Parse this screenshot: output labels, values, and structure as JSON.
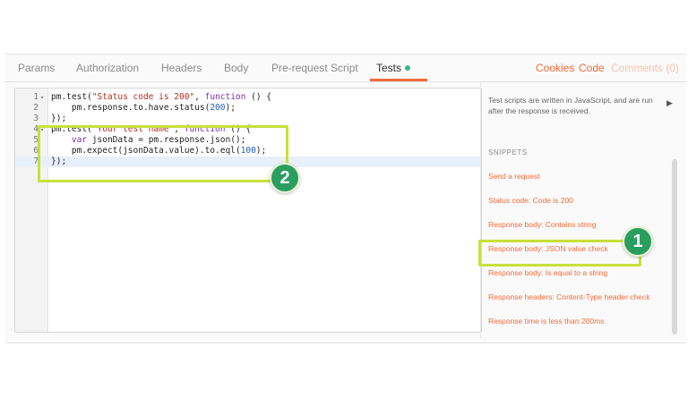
{
  "tabs": {
    "params": "Params",
    "authorization": "Authorization",
    "headers": "Headers",
    "body": "Body",
    "pre_request_script": "Pre-request Script",
    "tests": "Tests",
    "cookies": "Cookies",
    "code": "Code",
    "comments": "Comments (0)"
  },
  "editor": {
    "lines": [
      {
        "num": "1",
        "fold": "▾",
        "tokens": [
          [
            "pm.test(",
            ""
          ],
          [
            "\"Status code is 200\"",
            "str"
          ],
          [
            ", ",
            ""
          ],
          [
            "function",
            "kw"
          ],
          [
            " () {",
            ""
          ]
        ]
      },
      {
        "num": "2",
        "fold": "",
        "tokens": [
          [
            "    pm.response.to.have.status(",
            ""
          ],
          [
            "200",
            "num"
          ],
          [
            ");",
            ""
          ]
        ]
      },
      {
        "num": "3",
        "fold": "",
        "tokens": [
          [
            "});",
            ""
          ]
        ]
      },
      {
        "num": "4",
        "fold": "▾",
        "tokens": [
          [
            "pm.test(",
            ""
          ],
          [
            "\"Your test name\"",
            "str"
          ],
          [
            ", ",
            ""
          ],
          [
            "function",
            "kw"
          ],
          [
            " () {",
            ""
          ]
        ]
      },
      {
        "num": "5",
        "fold": "",
        "tokens": [
          [
            "    ",
            ""
          ],
          [
            "var",
            "kw"
          ],
          [
            " jsonData = pm.response.json();",
            ""
          ]
        ]
      },
      {
        "num": "6",
        "fold": "",
        "tokens": [
          [
            "    pm.expect(jsonData.value).to.eql(",
            ""
          ],
          [
            "100",
            "num"
          ],
          [
            ");",
            ""
          ]
        ]
      },
      {
        "num": "7",
        "fold": "",
        "tokens": [
          [
            "});",
            ""
          ]
        ]
      }
    ],
    "current_line": 7
  },
  "side": {
    "description": "Test scripts are written in JavaScript, and are run after the response is received.",
    "snippets_heading": "SNIPPETS",
    "snippets": [
      "Send a request",
      "Status code: Code is 200",
      "Response body: Contains string",
      "Response body: JSON value check",
      "Response body: Is equal to a string",
      "Response headers: Content-Type header check",
      "Response time is less than 200ms"
    ]
  },
  "annotations": {
    "badge_1": "1",
    "badge_2": "2"
  },
  "colors": {
    "accent": "#f26b3a",
    "status_dot": "#3bb88a",
    "highlight": "#c8e03a",
    "badge": "#2a9d60"
  }
}
